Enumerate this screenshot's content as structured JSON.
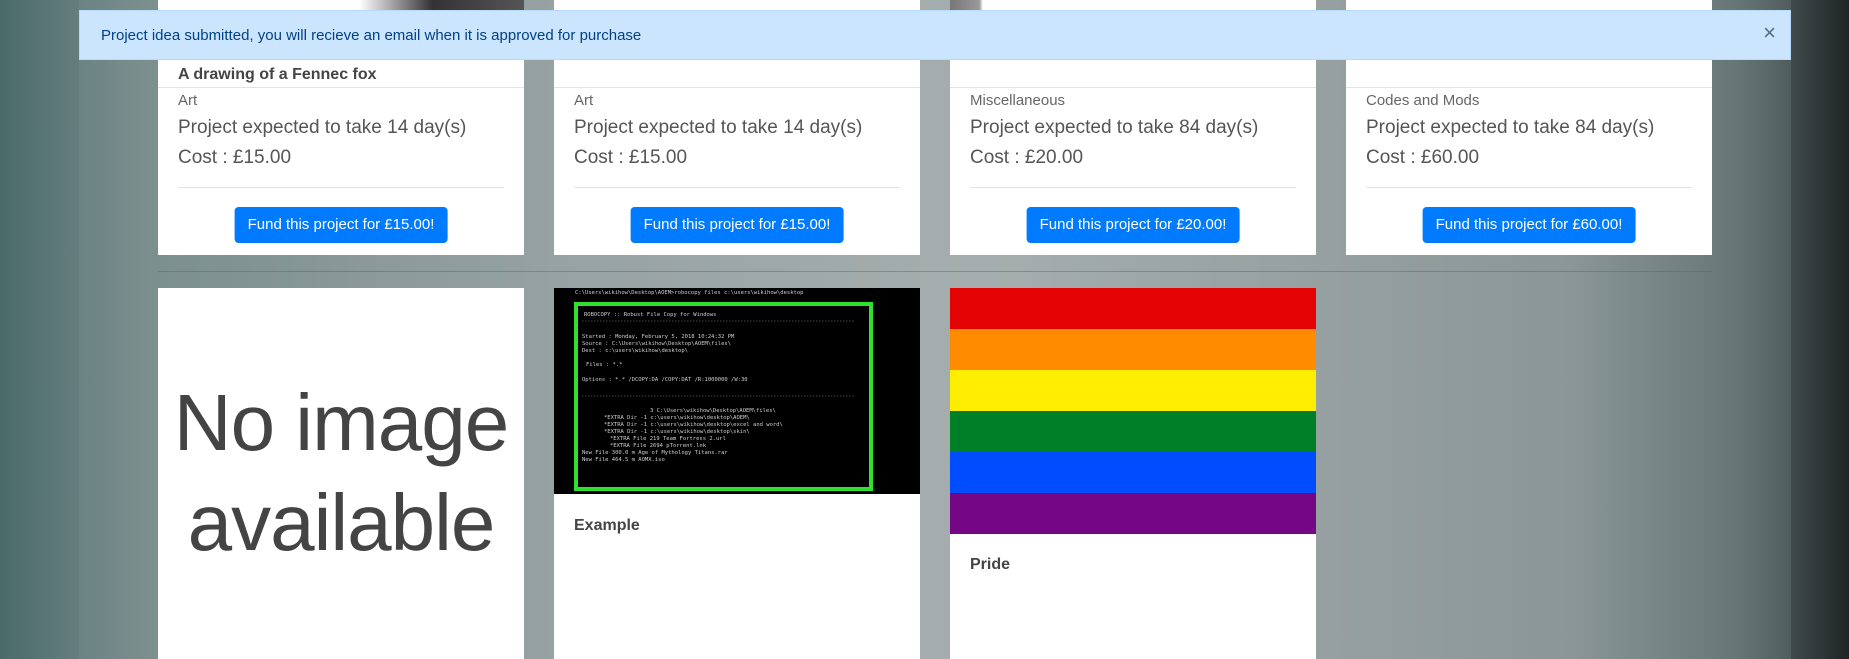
{
  "alert": {
    "message": "Project idea submitted, you will recieve an email when it is approved for purchase",
    "close_symbol": "×"
  },
  "top_cards": [
    {
      "title": "A drawing of a Fennec fox",
      "category": "Art",
      "duration": "Project expected to take 14 day(s)",
      "cost": "Cost : £15.00",
      "button": "Fund this project for £15.00!"
    },
    {
      "title": "",
      "category": "Art",
      "duration": "Project expected to take 14 day(s)",
      "cost": "Cost : £15.00",
      "button": "Fund this project for £15.00!"
    },
    {
      "title": "",
      "category": "Miscellaneous",
      "duration": "Project expected to take 84 day(s)",
      "cost": "Cost : £20.00",
      "button": "Fund this project for £20.00!"
    },
    {
      "title": "",
      "category": "Codes and Mods",
      "duration": "Project expected to take 84 day(s)",
      "cost": "Cost : £60.00",
      "button": "Fund this project for £60.00!"
    }
  ],
  "bottom_cards": [
    {
      "placeholder_line1": "No image",
      "placeholder_line2": "available",
      "title": ""
    },
    {
      "title": "Example",
      "terminal_lines": [
        "C:\\Users\\wikihow\\Desktop\\AOEM>robocopy files c:\\users\\wikihow\\desktop",
        "ROBOCOPY     ::     Robust File Copy for Windows",
        "Started : Monday, February 5, 2018 10:24:32 PM",
        "Source : C:\\Users\\wikihow\\Desktop\\AOEM\\files\\",
        "Dest : c:\\users\\wikihow\\desktop\\",
        "Files : *.*",
        "Options : *.* /DCOPY:DA /COPY:DAT /R:1000000 /W:30",
        "3    C:\\Users\\wikihow\\Desktop\\AOEM\\files\\",
        "*EXTRA Dir    -1    c:\\users\\wikihow\\desktop\\AOEM\\",
        "*EXTRA Dir    -1    c:\\users\\wikihow\\desktop\\excel and word\\",
        "*EXTRA Dir    -1    c:\\users\\wikihow\\desktop\\skin\\",
        "*EXTRA File         219      Team Fortress 2.url",
        "*EXTRA File         2694     pTorrent.lnk",
        "New File            300.0 m  Age of Mythology Titans.rar",
        "New File            464.5 m  AOMX.iso"
      ]
    },
    {
      "title": "Pride",
      "flag_colors": [
        "#e40303",
        "#ff8c00",
        "#ffed00",
        "#008026",
        "#004dff",
        "#750787"
      ]
    }
  ]
}
